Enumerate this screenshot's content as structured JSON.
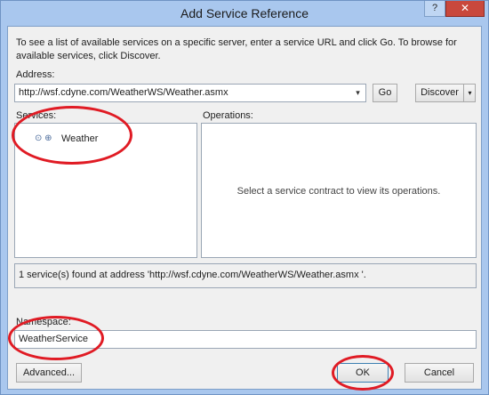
{
  "window": {
    "title": "Add Service Reference",
    "help_glyph": "?",
    "close_glyph": "✕"
  },
  "instructions": "To see a list of available services on a specific server, enter a service URL and click Go. To browse for available services, click Discover.",
  "address": {
    "label": "Address:",
    "value": "http://wsf.cdyne.com/WeatherWS/Weather.asmx",
    "dropdown_glyph": "▾"
  },
  "buttons": {
    "go": "Go",
    "discover": "Discover",
    "discover_arrow": "▾",
    "advanced": "Advanced...",
    "ok": "OK",
    "cancel": "Cancel"
  },
  "services": {
    "label": "Services:",
    "items": [
      {
        "label": "Weather",
        "icon": "service-globe-icon",
        "glyph": "⊙ ⊕"
      }
    ]
  },
  "operations": {
    "label": "Operations:",
    "placeholder": "Select a service contract to view its operations."
  },
  "status": "1 service(s) found at address 'http://wsf.cdyne.com/WeatherWS/Weather.asmx '.",
  "namespace": {
    "label": "Namespace:",
    "value": "WeatherService"
  },
  "colors": {
    "titlebar": "#a9c7ee",
    "dialog_bg": "#f0f0f0",
    "annotation_red": "#e01b24"
  }
}
